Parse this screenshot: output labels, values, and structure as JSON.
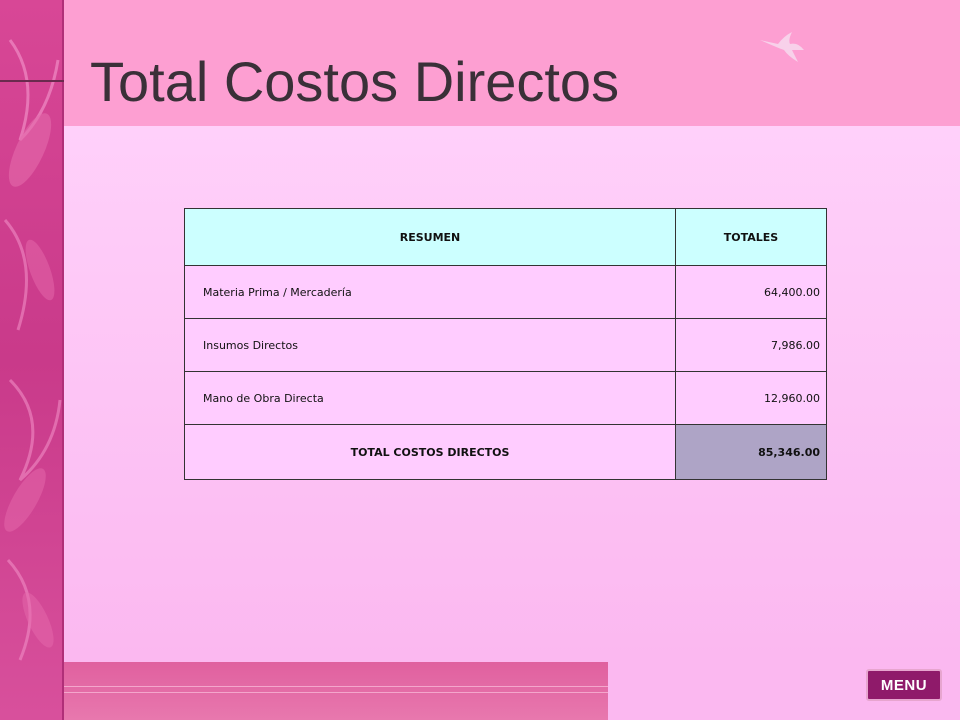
{
  "slide": {
    "title": "Total Costos Directos"
  },
  "table": {
    "headers": [
      "RESUMEN",
      "TOTALES"
    ],
    "rows": [
      {
        "label": "Materia Prima / Mercadería",
        "value": "64,400.00"
      },
      {
        "label": "Insumos Directos",
        "value": "7,986.00"
      },
      {
        "label": "Mano de Obra Directa",
        "value": "12,960.00"
      }
    ],
    "total": {
      "label": "TOTAL COSTOS DIRECTOS",
      "value": "85,346.00"
    }
  },
  "nav": {
    "menu_label": "MENU"
  },
  "icons": {
    "header_decoration": "hummingbird-icon",
    "side_decoration": "feather-pattern"
  },
  "colors": {
    "header_bg": "#fd9fd2",
    "body_bg": "#fbc6f4",
    "table_header_bg": "#ccffff",
    "table_row_bg": "#ffccff",
    "total_value_bg": "#aea4c6",
    "menu_button_bg": "#8f1a6a"
  }
}
